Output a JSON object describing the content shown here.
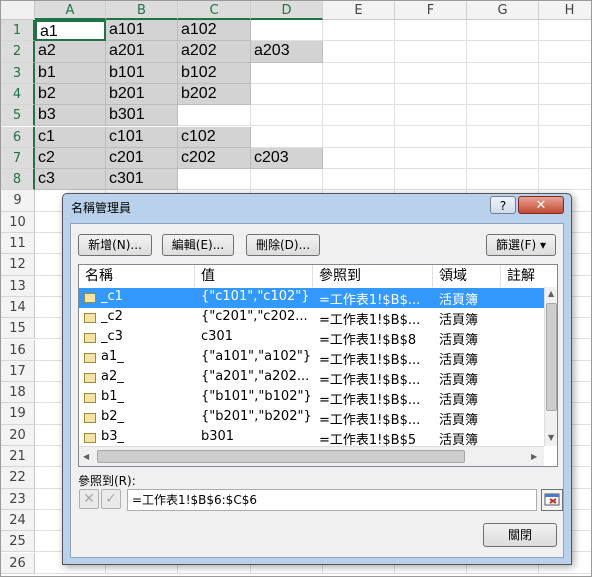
{
  "sheet": {
    "columns": [
      "A",
      "B",
      "C",
      "D",
      "E",
      "F",
      "G",
      "H"
    ],
    "rows": [
      "1",
      "2",
      "3",
      "4",
      "5",
      "6",
      "7",
      "8",
      "9",
      "10",
      "11",
      "12",
      "13",
      "14",
      "15",
      "16",
      "17",
      "18",
      "19",
      "20",
      "21",
      "22",
      "23",
      "24",
      "25",
      "26"
    ],
    "cells": [
      [
        "a1",
        "a101",
        "a102",
        ""
      ],
      [
        "a2",
        "a201",
        "a202",
        "a203"
      ],
      [
        "b1",
        "b101",
        "b102",
        ""
      ],
      [
        "b2",
        "b201",
        "b202",
        ""
      ],
      [
        "b3",
        "b301",
        "",
        ""
      ],
      [
        "c1",
        "c101",
        "c102",
        ""
      ],
      [
        "c2",
        "c201",
        "c202",
        "c203"
      ],
      [
        "c3",
        "c301",
        "",
        ""
      ]
    ]
  },
  "dialog": {
    "title": "名稱管理員",
    "help_label": "?",
    "close_label": "✕",
    "new_label": "新增(N)...",
    "edit_label": "編輯(E)...",
    "delete_label": "刪除(D)...",
    "filter_label": "篩選(F) ▾",
    "columns": [
      "名稱",
      "值",
      "參照到",
      "領域",
      "註解"
    ],
    "names": [
      {
        "name": "_c1",
        "value": "{\"c101\",\"c102\"}",
        "ref": "=工作表1!$B$...",
        "scope": "活頁簿",
        "selected": true
      },
      {
        "name": "_c2",
        "value": "{\"c201\",\"c202...",
        "ref": "=工作表1!$B$...",
        "scope": "活頁簿"
      },
      {
        "name": "_c3",
        "value": "c301",
        "ref": "=工作表1!$B$8",
        "scope": "活頁簿"
      },
      {
        "name": "a1_",
        "value": "{\"a101\",\"a102\"}",
        "ref": "=工作表1!$B$...",
        "scope": "活頁簿"
      },
      {
        "name": "a2_",
        "value": "{\"a201\",\"a202...",
        "ref": "=工作表1!$B$...",
        "scope": "活頁簿"
      },
      {
        "name": "b1_",
        "value": "{\"b101\",\"b102\"}",
        "ref": "=工作表1!$B$...",
        "scope": "活頁簿"
      },
      {
        "name": "b2_",
        "value": "{\"b201\",\"b202\"}",
        "ref": "=工作表1!$B$...",
        "scope": "活頁簿"
      },
      {
        "name": "b3_",
        "value": "b301",
        "ref": "=工作表1!$B$5",
        "scope": "活頁簿"
      }
    ],
    "refers_to_label": "參照到(R):",
    "refers_to_value": "=工作表1!$B$6:$C$6",
    "cancel_icon": "✕",
    "confirm_icon": "✓",
    "close_button_label": "關閉"
  }
}
